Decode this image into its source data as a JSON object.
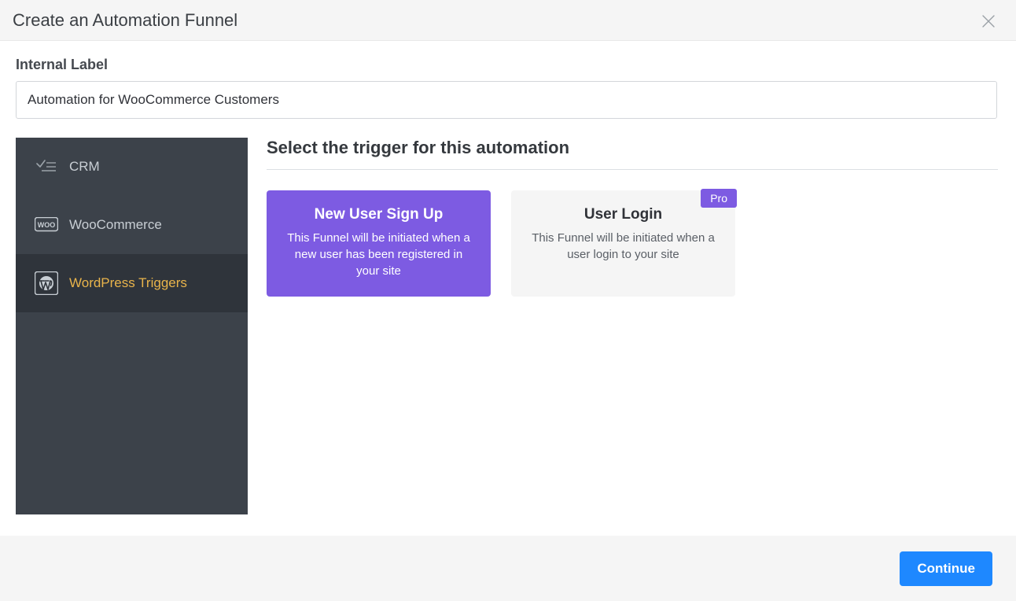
{
  "dialog": {
    "title": "Create an Automation Funnel"
  },
  "form": {
    "internal_label_caption": "Internal Label",
    "internal_label_value": "Automation for WooCommerce Customers"
  },
  "sidebar": {
    "items": [
      {
        "id": "crm",
        "label": "CRM",
        "active": false,
        "icon": "checklist"
      },
      {
        "id": "woocommerce",
        "label": "WooCommerce",
        "active": false,
        "icon": "woo"
      },
      {
        "id": "wordpress-triggers",
        "label": "WordPress Triggers",
        "active": true,
        "icon": "wordpress"
      }
    ]
  },
  "section": {
    "heading": "Select the trigger for this automation"
  },
  "cards": [
    {
      "id": "new-user-sign-up",
      "title": "New User Sign Up",
      "description": "This Funnel will be initiated when a new user has been registered in your site",
      "selected": true,
      "pro": false
    },
    {
      "id": "user-login",
      "title": "User Login",
      "description": "This Funnel will be initiated when a user login to your site",
      "selected": false,
      "pro": true,
      "badge_label": "Pro"
    }
  ],
  "footer": {
    "continue_label": "Continue"
  }
}
